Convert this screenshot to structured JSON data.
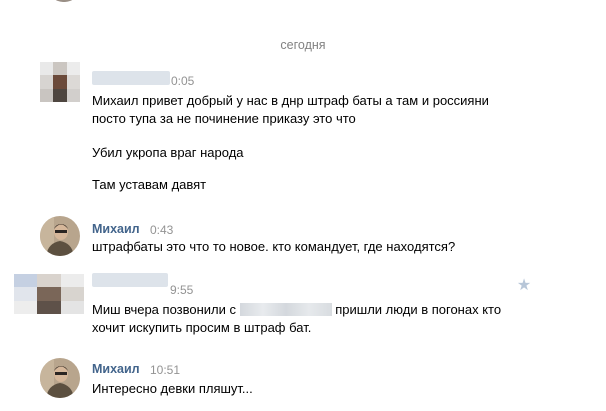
{
  "date_divider": "сегодня",
  "messages": [
    {
      "sender": "",
      "time": "0:05",
      "lines": [
        "Михаил привет добрый у нас в днр штраф баты а там и россияни посто тупа за не починение приказу это что",
        "Убил укропа враг народа",
        "Там уставам давят"
      ]
    },
    {
      "sender": "Михаил",
      "time": "0:43",
      "lines": [
        "штрафбаты это что то новое. кто командует, где находятся?"
      ]
    },
    {
      "sender": "",
      "time": "9:55",
      "text_before": "Миш вчера позвонили с",
      "text_after": "пришли люди в погонах кто хочит искупить просим в штраф бат."
    },
    {
      "sender": "Михаил",
      "time": "10:51",
      "lines": [
        "Интересно девки пляшут..."
      ]
    }
  ],
  "icons": {
    "star": "star-icon"
  },
  "colors": {
    "link_name": "#42648b",
    "time": "#939393",
    "date": "#828282",
    "star": "#b7c6d8"
  }
}
